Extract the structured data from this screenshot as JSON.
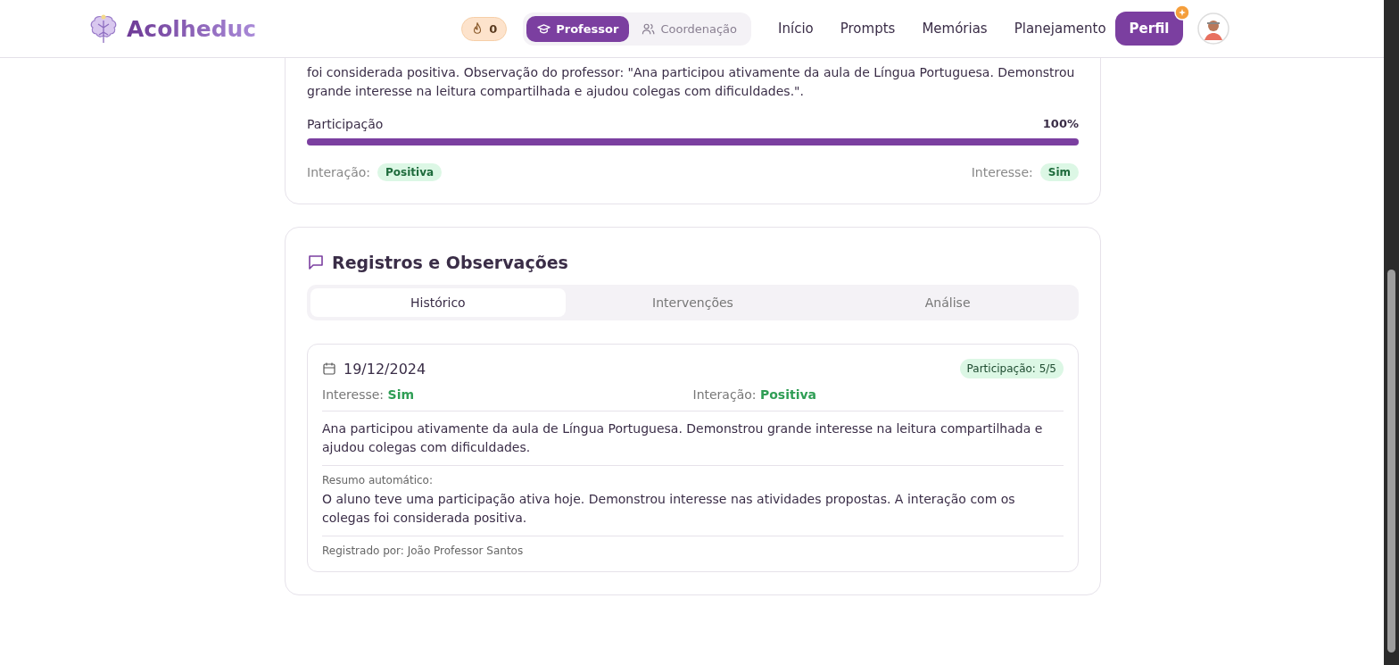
{
  "header": {
    "logo": "Acolheduc",
    "streak": "0",
    "role_toggle": [
      {
        "label": "Professor",
        "selected": true
      },
      {
        "label": "Coordenação",
        "selected": false
      }
    ],
    "nav": [
      "Início",
      "Prompts",
      "Memórias",
      "Planejamento"
    ],
    "profile_button": {
      "label": "Perfil",
      "badge": true
    }
  },
  "summary_card": {
    "text": "foi considerada positiva. Observação do professor: \"Ana participou ativamente da aula de Língua Portuguesa. Demonstrou grande interesse na leitura compartilhada e ajudou colegas com dificuldades.\".",
    "participation": {
      "label": "Participação",
      "reading": "100%",
      "level": 1
    },
    "interaction": {
      "label": "Interação:",
      "value": "Positiva"
    },
    "interest": {
      "label": "Interesse:",
      "value": "Sim"
    }
  },
  "records": {
    "title": "Registros e Observações",
    "tabs": [
      {
        "label": "Histórico",
        "selected": true
      },
      {
        "label": "Intervenções",
        "selected": false
      },
      {
        "label": "Análise",
        "selected": false
      }
    ],
    "entries": [
      {
        "date": "19/12/2024",
        "badge": "Participação: 5/5",
        "interest_label": "Interesse:",
        "interest": "Sim",
        "interaction_label": "Interação:",
        "interaction": "Positiva",
        "note": "Ana participou ativamente da aula de Língua Portuguesa. Demonstrou grande interesse na leitura compartilhada e ajudou colegas com dificuldades.",
        "summary_label": "Resumo automático:",
        "summary": "O aluno teve uma participação ativa hoje. Demonstrou interesse nas atividades propostas. A interação com os colegas foi considerada positiva.",
        "author": "Registrado por: João Professor Santos"
      }
    ]
  }
}
